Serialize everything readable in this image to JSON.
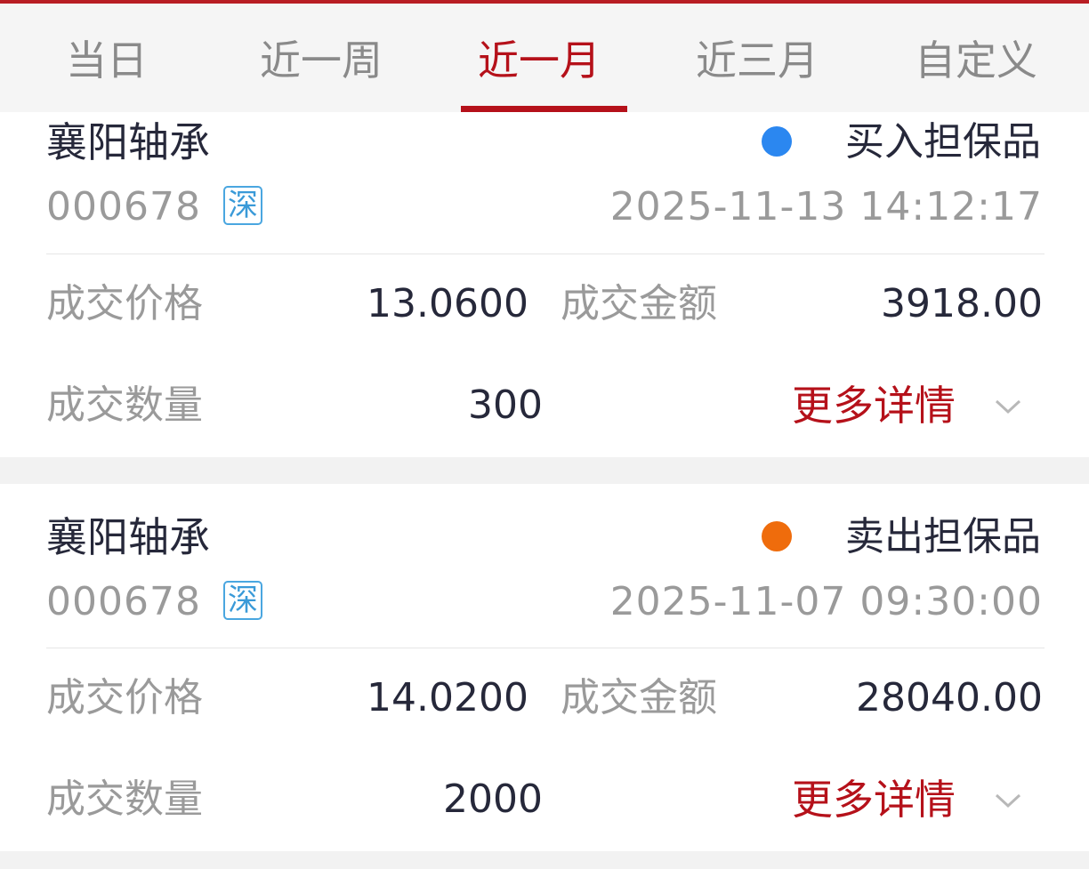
{
  "tabs": [
    {
      "label": "当日",
      "active": false
    },
    {
      "label": "近一周",
      "active": false
    },
    {
      "label": "近一月",
      "active": true
    },
    {
      "label": "近三月",
      "active": false
    },
    {
      "label": "自定义",
      "active": false
    }
  ],
  "records": [
    {
      "name": "襄阳轴承",
      "code": "000678",
      "market": "深",
      "type_label": "买入担保品",
      "type_color": "#2b87f0",
      "time": "2025-11-13 14:12:17",
      "price_label": "成交价格",
      "price": "13.0600",
      "amount_label": "成交金额",
      "amount": "3918.00",
      "qty_label": "成交数量",
      "qty": "300",
      "more_label": "更多详情"
    },
    {
      "name": "襄阳轴承",
      "code": "000678",
      "market": "深",
      "type_label": "卖出担保品",
      "type_color": "#ef6c0c",
      "time": "2025-11-07 09:30:00",
      "price_label": "成交价格",
      "price": "14.0200",
      "amount_label": "成交金额",
      "amount": "28040.00",
      "qty_label": "成交数量",
      "qty": "2000",
      "more_label": "更多详情"
    }
  ],
  "colors": {
    "accent": "#b5111a",
    "buy_dot": "#2b87f0",
    "sell_dot": "#ef6c0c",
    "market_badge": "#3a9ad8"
  },
  "icons": {
    "chevron": "chevron-down-icon"
  }
}
